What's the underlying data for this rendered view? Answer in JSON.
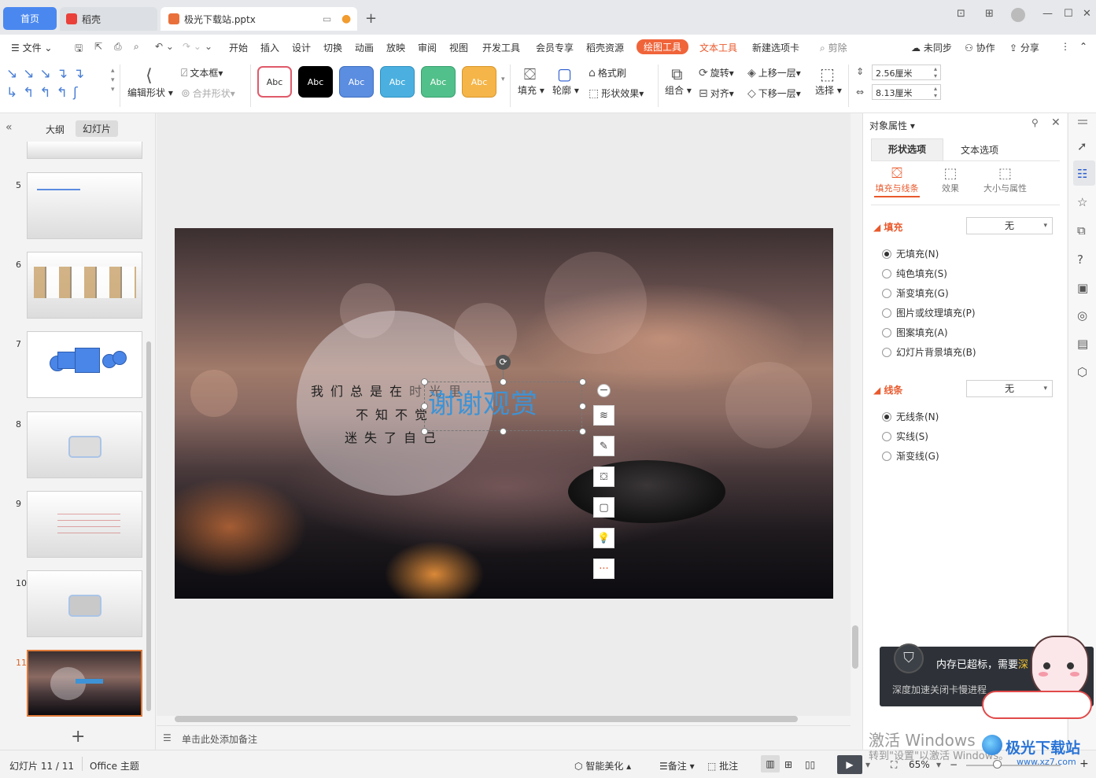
{
  "titlebar": {
    "home_tab": "首页",
    "docer_tab": "稻壳",
    "file_tab": "极光下载站.pptx",
    "new_tab": "+"
  },
  "menu": {
    "file": "文件",
    "items": [
      "开始",
      "插入",
      "设计",
      "切换",
      "动画",
      "放映",
      "审阅",
      "视图",
      "开发工具",
      "会员专享",
      "稻壳资源"
    ],
    "draw_tools": "绘图工具",
    "text_tools": "文本工具",
    "new_tab": "新建选项卡",
    "search": "剪除",
    "sync": "未同步",
    "collab": "协作",
    "share": "分享"
  },
  "ribbon": {
    "edit_shape": "编辑形状",
    "text_box": "文本框",
    "merge_shape": "合并形状",
    "style_sample": "Abc",
    "fill": "填充",
    "outline": "轮廓",
    "format_painter": "格式刷",
    "shape_effect": "形状效果",
    "group": "组合",
    "rotate": "旋转",
    "align": "对齐",
    "bring_forward": "上移一层",
    "send_backward": "下移一层",
    "select": "选择",
    "height": "2.56厘米",
    "width": "8.13厘米"
  },
  "style_colors": [
    "#ffffff",
    "#000000",
    "#5b8de0",
    "#4bb0e0",
    "#52c08a",
    "#f5b548"
  ],
  "left_panel": {
    "outline_tab": "大纲",
    "slides_tab": "幻灯片",
    "slide_numbers": [
      "5",
      "6",
      "7",
      "8",
      "9",
      "10",
      "11"
    ],
    "add": "+"
  },
  "slide": {
    "poem_line1": "我们总是在",
    "poem_line1b": "时光里",
    "poem_line2": "不知不觉",
    "poem_line3": "迷失了自己",
    "title": "谢谢观赏",
    "float_more": "···"
  },
  "notes": {
    "placeholder": "单击此处添加备注"
  },
  "right_panel": {
    "title": "对象属性",
    "tab_shape": "形状选项",
    "tab_text": "文本选项",
    "sub_fill_line": "填充与线条",
    "sub_effect": "效果",
    "sub_size": "大小与属性",
    "fill_title": "填充",
    "fill_value": "无",
    "fill_options": [
      "无填充(N)",
      "纯色填充(S)",
      "渐变填充(G)",
      "图片或纹理填充(P)",
      "图案填充(A)",
      "幻灯片背景填充(B)"
    ],
    "line_title": "线条",
    "line_value": "无",
    "line_options": [
      "无线条(N)",
      "实线(S)",
      "渐变线(G)"
    ]
  },
  "toast": {
    "title": "内存已超标，需要",
    "title_highlight": "深",
    "body": "深度加速关闭卡慢进程"
  },
  "statusbar": {
    "slide_count": "幻灯片 11 / 11",
    "theme": "Office 主题",
    "beautify": "智能美化",
    "notes": "备注",
    "comments": "批注",
    "zoom": "65%"
  },
  "watermark": {
    "activate": "激活 Windows",
    "activate_sub": "转到\"设置\"以激活 Windows。",
    "site": "极光下载站",
    "url": "www.xz7.com"
  }
}
